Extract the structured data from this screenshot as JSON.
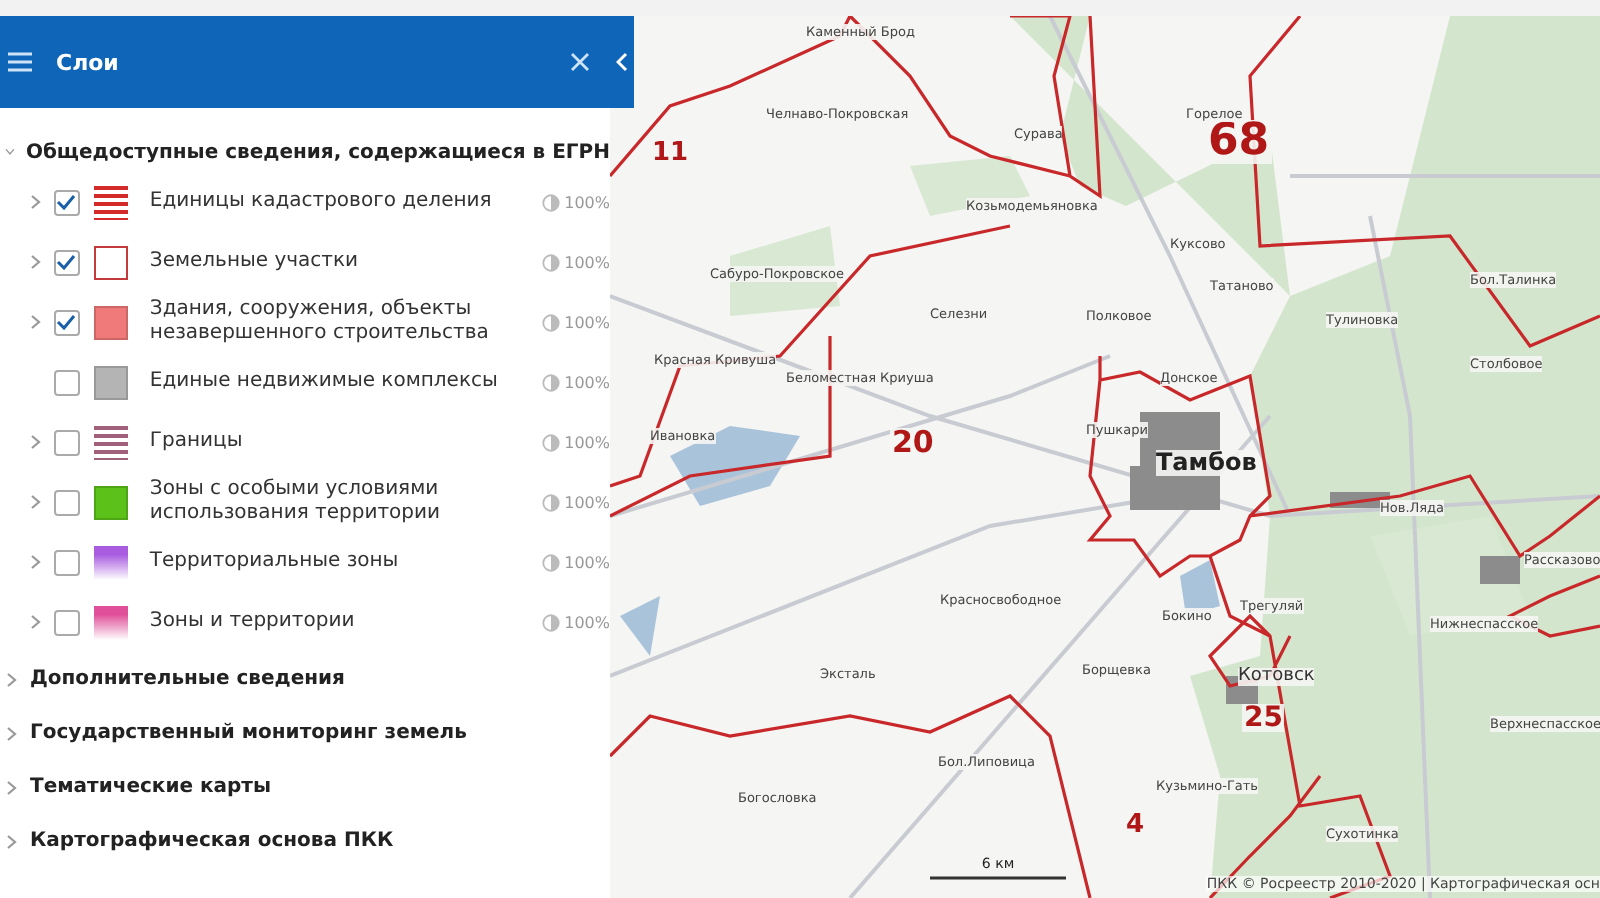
{
  "panel": {
    "title": "Слои",
    "sections": [
      {
        "title": "Общедоступные сведения, содержащиеся в ЕГРН",
        "expanded": true,
        "layers": [
          {
            "name": "Единицы кадастрового деления",
            "checked": true,
            "expandable": true,
            "swatch": {
              "kind": "stripes",
              "color": "#d42a2a"
            },
            "opacity": "100%"
          },
          {
            "name": "Земельные участки",
            "checked": true,
            "expandable": true,
            "swatch": {
              "kind": "outline",
              "color": "#c23a3a"
            },
            "opacity": "100%"
          },
          {
            "name": "Здания, сооружения, объекты незавершенного строительства",
            "checked": true,
            "expandable": true,
            "swatch": {
              "kind": "solid",
              "color": "#f07a7a"
            },
            "opacity": "100%"
          },
          {
            "name": "Единые недвижимые комплексы",
            "checked": false,
            "expandable": false,
            "swatch": {
              "kind": "solid",
              "color": "#b4b4b4"
            },
            "opacity": "100%"
          },
          {
            "name": "Границы",
            "checked": false,
            "expandable": true,
            "swatch": {
              "kind": "stripes",
              "color": "#a0607a"
            },
            "opacity": "100%"
          },
          {
            "name": "Зоны с особыми условиями использования территории",
            "checked": false,
            "expandable": true,
            "swatch": {
              "kind": "solid",
              "color": "#5cc21a"
            },
            "opacity": "100%"
          },
          {
            "name": "Территориальные зоны",
            "checked": false,
            "expandable": true,
            "swatch": {
              "kind": "gradient",
              "color": "#a95ce0"
            },
            "opacity": "100%"
          },
          {
            "name": "Зоны и территории",
            "checked": false,
            "expandable": true,
            "swatch": {
              "kind": "gradient",
              "color": "#e0509a"
            },
            "opacity": "100%"
          }
        ]
      },
      {
        "title": "Дополнительные сведения",
        "expanded": false
      },
      {
        "title": "Государственный мониторинг земель",
        "expanded": false
      },
      {
        "title": "Тематические карты",
        "expanded": false
      },
      {
        "title": "Картографическая основа ПКК",
        "expanded": false
      }
    ]
  },
  "map": {
    "district_numbers": [
      "11",
      "68",
      "20",
      "25",
      "4"
    ],
    "places": [
      "Каменный Брод",
      "Челнаво-Покровская",
      "Сурава",
      "Горелое",
      "Козьмодемьяновка",
      "Куксово",
      "Сабуро-Покровское",
      "Татаново",
      "Бол.Талинка",
      "Селезни",
      "Полковое",
      "Тулиновка",
      "Красная Кривуша",
      "Беломестная Криуша",
      "Донское",
      "Столбовое",
      "Пушкари",
      "Ивановка",
      "Нов.Ляда",
      "Рассказово",
      "Красносвободное",
      "Бокино",
      "Трегуляй",
      "Нижнеспасское",
      "Борщевка",
      "Эксталь",
      "Верхнеспасское",
      "Бол.Липовица",
      "Богословка",
      "Кузьмино-Гать",
      "Сухотинка"
    ],
    "city": "Тамбов",
    "town": "Котовск",
    "scale": "6 км",
    "attribution": "ПКК © Росреестр 2010-2020 | Картографическая осн"
  }
}
